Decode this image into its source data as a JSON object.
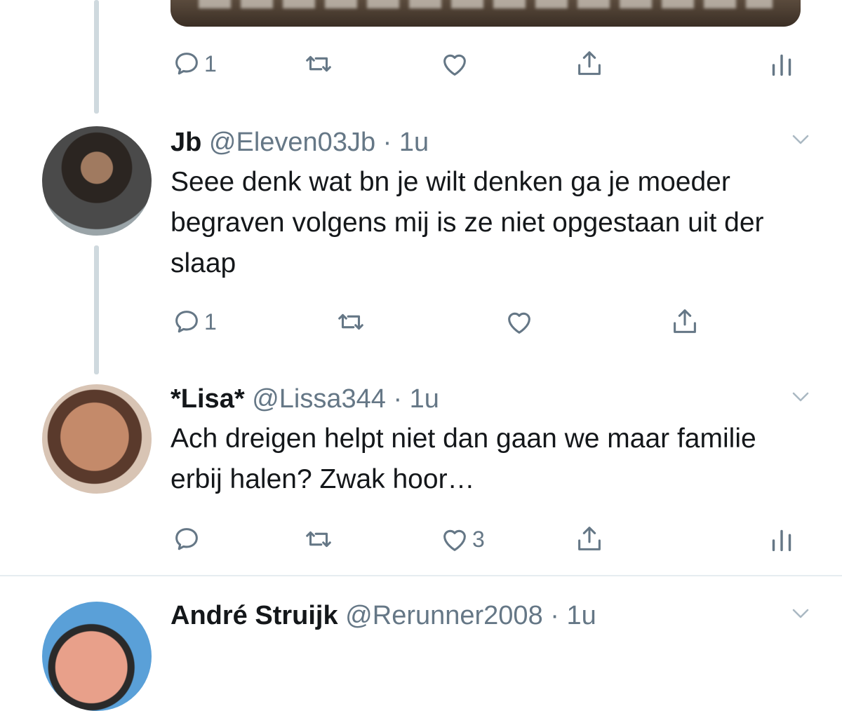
{
  "colors": {
    "text": "#14171a",
    "muted": "#657786",
    "thread": "#cfd9de",
    "divider": "#e6ecf0"
  },
  "top_actions": {
    "reply_count": "1"
  },
  "tweets": [
    {
      "name": "Jb",
      "handle": "@Eleven03Jb",
      "separator": "·",
      "time": "1u",
      "text": "Seee denk wat bn je wilt denken ga je moeder begraven volgens mij is ze niet opgestaan  uit der slaap",
      "reply_count": "1",
      "like_count": ""
    },
    {
      "name": "*Lisa*",
      "handle": "@Lissa344",
      "separator": "·",
      "time": "1u",
      "text": "Ach dreigen helpt niet dan gaan we maar familie erbij halen? Zwak hoor…",
      "reply_count": "",
      "like_count": "3"
    },
    {
      "name": "André Struijk",
      "handle": "@Rerunner2008",
      "separator": "·",
      "time": "1u"
    }
  ]
}
